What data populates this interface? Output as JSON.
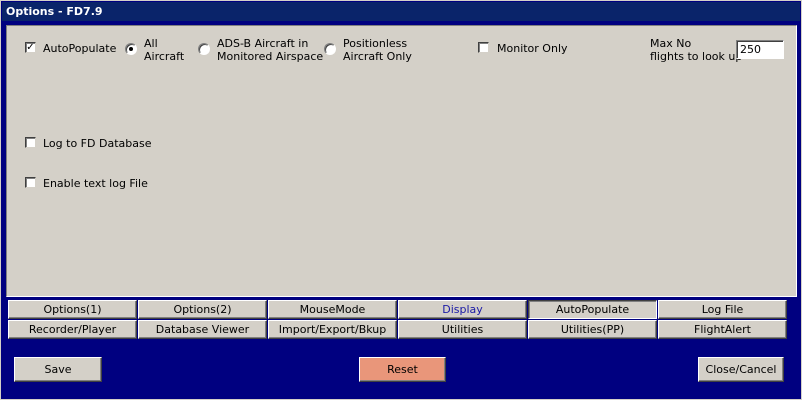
{
  "window": {
    "title": "Options - FD7.9"
  },
  "autopopulate": {
    "autopopulate_label": "AutoPopulate",
    "autopopulate_checked": "✓",
    "radio_all_line1": "All",
    "radio_all_line2": "Aircraft",
    "radio_adsb_line1": "ADS-B Aircraft in",
    "radio_adsb_line2": "Monitored Airspace",
    "radio_positionless_line1": "Positionless",
    "radio_positionless_line2": "Aircraft Only",
    "monitor_only_label": "Monitor Only",
    "max_flights_line1": "Max No",
    "max_flights_line2": "flights to look up",
    "max_flights_value": "250",
    "log_db_label": "Log to FD Database",
    "text_log_label": "Enable text log File"
  },
  "tabs": {
    "row1": [
      "Options(1)",
      "Options(2)",
      "MouseMode",
      "Display",
      "AutoPopulate",
      "Log File"
    ],
    "row2": [
      "Recorder/Player",
      "Database Viewer",
      "Import/Export/Bkup",
      "Utilities",
      "Utilities(PP)",
      "FlightAlert"
    ]
  },
  "footer": {
    "save_label": "Save",
    "reset_label": "Reset",
    "close_label": "Close/Cancel"
  },
  "colors": {
    "window_bg": "#000080",
    "panel_bg": "#d4d0c8",
    "titlebar": "#0a246a",
    "reset_button": "#e9967a"
  }
}
